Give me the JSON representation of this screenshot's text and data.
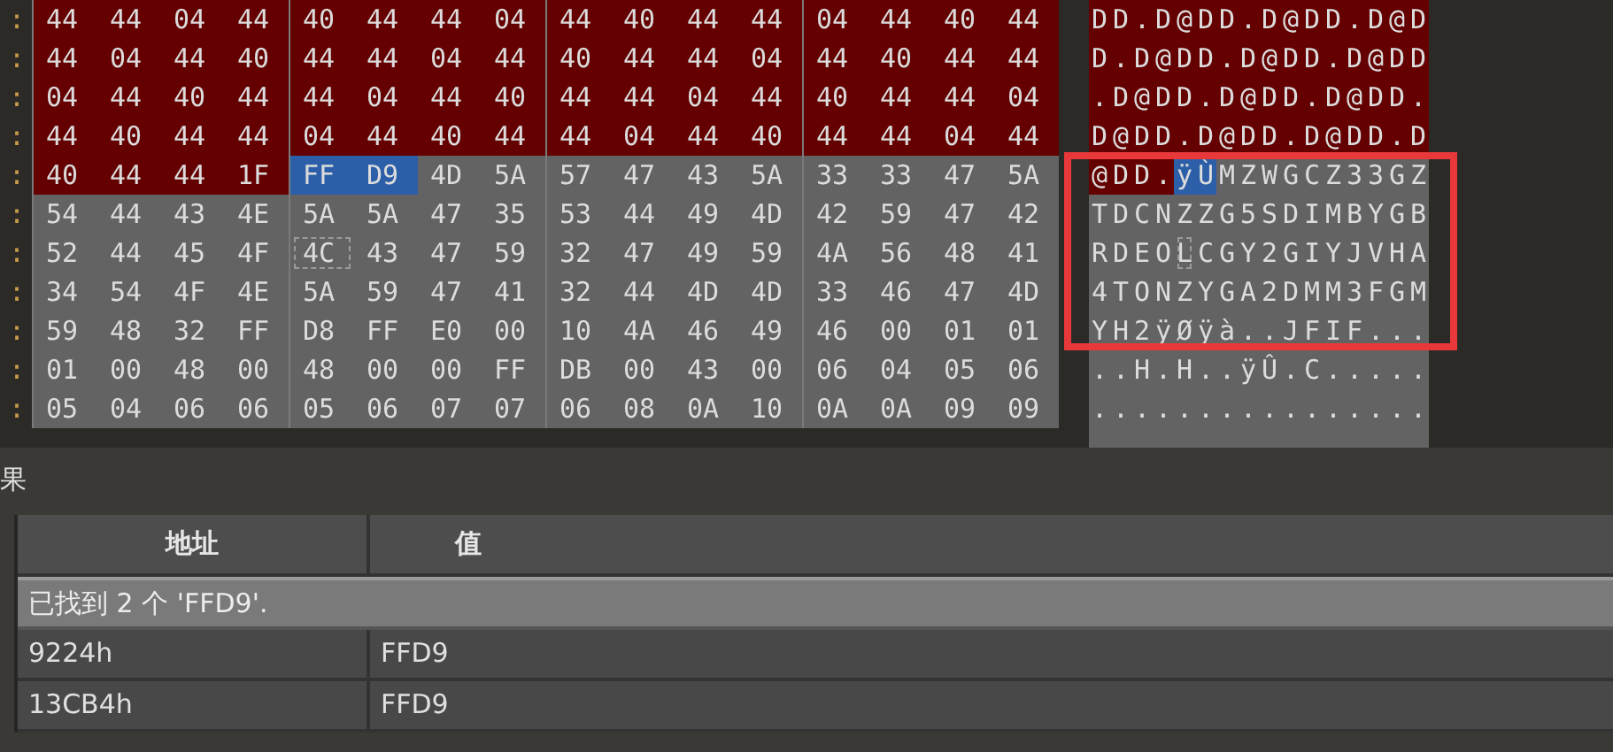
{
  "hex_view": {
    "rows": [
      {
        "address": ":",
        "bytes": [
          {
            "hex": "44",
            "kind": "marked",
            "selected": false
          },
          {
            "hex": "44",
            "kind": "marked",
            "selected": false
          },
          {
            "hex": "04",
            "kind": "marked",
            "selected": false
          },
          {
            "hex": "44",
            "kind": "marked",
            "selected": false
          },
          {
            "hex": "40",
            "kind": "marked",
            "selected": false
          },
          {
            "hex": "44",
            "kind": "marked",
            "selected": false
          },
          {
            "hex": "44",
            "kind": "marked",
            "selected": false
          },
          {
            "hex": "04",
            "kind": "marked",
            "selected": false
          },
          {
            "hex": "44",
            "kind": "marked",
            "selected": false
          },
          {
            "hex": "40",
            "kind": "marked",
            "selected": false
          },
          {
            "hex": "44",
            "kind": "marked",
            "selected": false
          },
          {
            "hex": "44",
            "kind": "marked",
            "selected": false
          },
          {
            "hex": "04",
            "kind": "marked",
            "selected": false
          },
          {
            "hex": "44",
            "kind": "marked",
            "selected": false
          },
          {
            "hex": "40",
            "kind": "marked",
            "selected": false
          },
          {
            "hex": "44",
            "kind": "marked",
            "selected": false
          }
        ],
        "ascii": "DD.D@DD.D@DD.D@D"
      },
      {
        "address": ":",
        "bytes": [
          {
            "hex": "44",
            "kind": "marked",
            "selected": false
          },
          {
            "hex": "04",
            "kind": "marked",
            "selected": false
          },
          {
            "hex": "44",
            "kind": "marked",
            "selected": false
          },
          {
            "hex": "40",
            "kind": "marked",
            "selected": false
          },
          {
            "hex": "44",
            "kind": "marked",
            "selected": false
          },
          {
            "hex": "44",
            "kind": "marked",
            "selected": false
          },
          {
            "hex": "04",
            "kind": "marked",
            "selected": false
          },
          {
            "hex": "44",
            "kind": "marked",
            "selected": false
          },
          {
            "hex": "40",
            "kind": "marked",
            "selected": false
          },
          {
            "hex": "44",
            "kind": "marked",
            "selected": false
          },
          {
            "hex": "44",
            "kind": "marked",
            "selected": false
          },
          {
            "hex": "04",
            "kind": "marked",
            "selected": false
          },
          {
            "hex": "44",
            "kind": "marked",
            "selected": false
          },
          {
            "hex": "40",
            "kind": "marked",
            "selected": false
          },
          {
            "hex": "44",
            "kind": "marked",
            "selected": false
          },
          {
            "hex": "44",
            "kind": "marked",
            "selected": false
          }
        ],
        "ascii": "D.D@DD.D@DD.D@DD"
      },
      {
        "address": ":",
        "bytes": [
          {
            "hex": "04",
            "kind": "marked",
            "selected": false
          },
          {
            "hex": "44",
            "kind": "marked",
            "selected": false
          },
          {
            "hex": "40",
            "kind": "marked",
            "selected": false
          },
          {
            "hex": "44",
            "kind": "marked",
            "selected": false
          },
          {
            "hex": "44",
            "kind": "marked",
            "selected": false
          },
          {
            "hex": "04",
            "kind": "marked",
            "selected": false
          },
          {
            "hex": "44",
            "kind": "marked",
            "selected": false
          },
          {
            "hex": "40",
            "kind": "marked",
            "selected": false
          },
          {
            "hex": "44",
            "kind": "marked",
            "selected": false
          },
          {
            "hex": "44",
            "kind": "marked",
            "selected": false
          },
          {
            "hex": "04",
            "kind": "marked",
            "selected": false
          },
          {
            "hex": "44",
            "kind": "marked",
            "selected": false
          },
          {
            "hex": "40",
            "kind": "marked",
            "selected": false
          },
          {
            "hex": "44",
            "kind": "marked",
            "selected": false
          },
          {
            "hex": "44",
            "kind": "marked",
            "selected": false
          },
          {
            "hex": "04",
            "kind": "marked",
            "selected": false
          }
        ],
        "ascii": ".D@DD.D@DD.D@DD."
      },
      {
        "address": ":",
        "bytes": [
          {
            "hex": "44",
            "kind": "marked",
            "selected": false
          },
          {
            "hex": "40",
            "kind": "marked",
            "selected": false
          },
          {
            "hex": "44",
            "kind": "marked",
            "selected": false
          },
          {
            "hex": "44",
            "kind": "marked",
            "selected": false
          },
          {
            "hex": "04",
            "kind": "marked",
            "selected": false
          },
          {
            "hex": "44",
            "kind": "marked",
            "selected": false
          },
          {
            "hex": "40",
            "kind": "marked",
            "selected": false
          },
          {
            "hex": "44",
            "kind": "marked",
            "selected": false
          },
          {
            "hex": "44",
            "kind": "marked",
            "selected": false
          },
          {
            "hex": "04",
            "kind": "marked",
            "selected": false
          },
          {
            "hex": "44",
            "kind": "marked",
            "selected": false
          },
          {
            "hex": "40",
            "kind": "marked",
            "selected": false
          },
          {
            "hex": "44",
            "kind": "marked",
            "selected": false
          },
          {
            "hex": "44",
            "kind": "marked",
            "selected": false
          },
          {
            "hex": "04",
            "kind": "marked",
            "selected": false
          },
          {
            "hex": "44",
            "kind": "marked",
            "selected": false
          }
        ],
        "ascii": "D@DD.D@DD.D@DD.D"
      },
      {
        "address": ":",
        "bytes": [
          {
            "hex": "40",
            "kind": "marked",
            "selected": false
          },
          {
            "hex": "44",
            "kind": "marked",
            "selected": false
          },
          {
            "hex": "44",
            "kind": "marked",
            "selected": false
          },
          {
            "hex": "1F",
            "kind": "marked",
            "selected": false
          },
          {
            "hex": "FF",
            "selected": true
          },
          {
            "hex": "D9",
            "selected": true
          },
          {
            "hex": "4D",
            "kind": "plain",
            "selected": false
          },
          {
            "hex": "5A",
            "kind": "plain",
            "selected": false
          },
          {
            "hex": "57",
            "kind": "plain",
            "selected": false
          },
          {
            "hex": "47",
            "kind": "plain",
            "selected": false
          },
          {
            "hex": "43",
            "kind": "plain",
            "selected": false
          },
          {
            "hex": "5A",
            "kind": "plain",
            "selected": false
          },
          {
            "hex": "33",
            "kind": "plain",
            "selected": false
          },
          {
            "hex": "33",
            "kind": "plain",
            "selected": false
          },
          {
            "hex": "47",
            "kind": "plain",
            "selected": false
          },
          {
            "hex": "5A",
            "kind": "plain",
            "selected": false
          }
        ],
        "ascii": "@DD.ÿÙMZWGCZ33GZ"
      },
      {
        "address": ":",
        "bytes": [
          {
            "hex": "54",
            "kind": "plain",
            "selected": false
          },
          {
            "hex": "44",
            "kind": "plain",
            "selected": false
          },
          {
            "hex": "43",
            "kind": "plain",
            "selected": false
          },
          {
            "hex": "4E",
            "kind": "plain",
            "selected": false
          },
          {
            "hex": "5A",
            "kind": "plain",
            "selected": false
          },
          {
            "hex": "5A",
            "kind": "plain",
            "selected": false
          },
          {
            "hex": "47",
            "kind": "plain",
            "selected": false
          },
          {
            "hex": "35",
            "kind": "plain",
            "selected": false
          },
          {
            "hex": "53",
            "kind": "plain",
            "selected": false
          },
          {
            "hex": "44",
            "kind": "plain",
            "selected": false
          },
          {
            "hex": "49",
            "kind": "plain",
            "selected": false
          },
          {
            "hex": "4D",
            "kind": "plain",
            "selected": false
          },
          {
            "hex": "42",
            "kind": "plain",
            "selected": false
          },
          {
            "hex": "59",
            "kind": "plain",
            "selected": false
          },
          {
            "hex": "47",
            "kind": "plain",
            "selected": false
          },
          {
            "hex": "42",
            "kind": "plain",
            "selected": false
          }
        ],
        "ascii": "TDCNZZG5SDIMBYGB"
      },
      {
        "address": ":",
        "bytes": [
          {
            "hex": "52",
            "kind": "plain",
            "selected": false
          },
          {
            "hex": "44",
            "kind": "plain",
            "selected": false
          },
          {
            "hex": "45",
            "kind": "plain",
            "selected": false
          },
          {
            "hex": "4F",
            "kind": "plain",
            "selected": false
          },
          {
            "hex": "4C",
            "kind": "cursor",
            "selected": false
          },
          {
            "hex": "43",
            "kind": "plain",
            "selected": false
          },
          {
            "hex": "47",
            "kind": "plain",
            "selected": false
          },
          {
            "hex": "59",
            "kind": "plain",
            "selected": false
          },
          {
            "hex": "32",
            "kind": "plain",
            "selected": false
          },
          {
            "hex": "47",
            "kind": "plain",
            "selected": false
          },
          {
            "hex": "49",
            "kind": "plain",
            "selected": false
          },
          {
            "hex": "59",
            "kind": "plain",
            "selected": false
          },
          {
            "hex": "4A",
            "kind": "plain",
            "selected": false
          },
          {
            "hex": "56",
            "kind": "plain",
            "selected": false
          },
          {
            "hex": "48",
            "kind": "plain",
            "selected": false
          },
          {
            "hex": "41",
            "kind": "plain",
            "selected": false
          }
        ],
        "ascii": "RDEOLCGY2GIYJVHA"
      },
      {
        "address": ":",
        "bytes": [
          {
            "hex": "34",
            "kind": "plain",
            "selected": false
          },
          {
            "hex": "54",
            "kind": "plain",
            "selected": false
          },
          {
            "hex": "4F",
            "kind": "plain",
            "selected": false
          },
          {
            "hex": "4E",
            "kind": "plain",
            "selected": false
          },
          {
            "hex": "5A",
            "kind": "plain",
            "selected": false
          },
          {
            "hex": "59",
            "kind": "plain",
            "selected": false
          },
          {
            "hex": "47",
            "kind": "plain",
            "selected": false
          },
          {
            "hex": "41",
            "kind": "plain",
            "selected": false
          },
          {
            "hex": "32",
            "kind": "plain",
            "selected": false
          },
          {
            "hex": "44",
            "kind": "plain",
            "selected": false
          },
          {
            "hex": "4D",
            "kind": "plain",
            "selected": false
          },
          {
            "hex": "4D",
            "kind": "plain",
            "selected": false
          },
          {
            "hex": "33",
            "kind": "plain",
            "selected": false
          },
          {
            "hex": "46",
            "kind": "plain",
            "selected": false
          },
          {
            "hex": "47",
            "kind": "plain",
            "selected": false
          },
          {
            "hex": "4D",
            "kind": "plain",
            "selected": false
          }
        ],
        "ascii": "4TONZYGA2DMM3FGM"
      },
      {
        "address": ":",
        "bytes": [
          {
            "hex": "59",
            "kind": "plain",
            "selected": false
          },
          {
            "hex": "48",
            "kind": "plain",
            "selected": false
          },
          {
            "hex": "32",
            "kind": "plain",
            "selected": false
          },
          {
            "hex": "FF",
            "kind": "plain",
            "selected": false
          },
          {
            "hex": "D8",
            "kind": "plain",
            "selected": false
          },
          {
            "hex": "FF",
            "kind": "plain",
            "selected": false
          },
          {
            "hex": "E0",
            "kind": "plain",
            "selected": false
          },
          {
            "hex": "00",
            "kind": "plain",
            "selected": false
          },
          {
            "hex": "10",
            "kind": "plain",
            "selected": false
          },
          {
            "hex": "4A",
            "kind": "plain",
            "selected": false
          },
          {
            "hex": "46",
            "kind": "plain",
            "selected": false
          },
          {
            "hex": "49",
            "kind": "plain",
            "selected": false
          },
          {
            "hex": "46",
            "kind": "plain",
            "selected": false
          },
          {
            "hex": "00",
            "kind": "plain",
            "selected": false
          },
          {
            "hex": "01",
            "kind": "plain",
            "selected": false
          },
          {
            "hex": "01",
            "kind": "plain",
            "selected": false
          }
        ],
        "ascii": "YH2ÿØÿà..JFIF..."
      },
      {
        "address": ":",
        "bytes": [
          {
            "hex": "01",
            "kind": "plain",
            "selected": false
          },
          {
            "hex": "00",
            "kind": "plain",
            "selected": false
          },
          {
            "hex": "48",
            "kind": "plain",
            "selected": false
          },
          {
            "hex": "00",
            "kind": "plain",
            "selected": false
          },
          {
            "hex": "48",
            "kind": "plain",
            "selected": false
          },
          {
            "hex": "00",
            "kind": "plain",
            "selected": false
          },
          {
            "hex": "00",
            "kind": "plain",
            "selected": false
          },
          {
            "hex": "FF",
            "kind": "plain",
            "selected": false
          },
          {
            "hex": "DB",
            "kind": "plain",
            "selected": false
          },
          {
            "hex": "00",
            "kind": "plain",
            "selected": false
          },
          {
            "hex": "43",
            "kind": "plain",
            "selected": false
          },
          {
            "hex": "00",
            "kind": "plain",
            "selected": false
          },
          {
            "hex": "06",
            "kind": "plain",
            "selected": false
          },
          {
            "hex": "04",
            "kind": "plain",
            "selected": false
          },
          {
            "hex": "05",
            "kind": "plain",
            "selected": false
          },
          {
            "hex": "06",
            "kind": "plain",
            "selected": false
          }
        ],
        "ascii": "..H.H..ÿÛ.C....."
      },
      {
        "address": ":",
        "bytes": [
          {
            "hex": "05",
            "kind": "plain",
            "selected": false
          },
          {
            "hex": "04",
            "kind": "plain",
            "selected": false
          },
          {
            "hex": "06",
            "kind": "plain",
            "selected": false
          },
          {
            "hex": "06",
            "kind": "plain",
            "selected": false
          },
          {
            "hex": "05",
            "kind": "plain",
            "selected": false
          },
          {
            "hex": "06",
            "kind": "plain",
            "selected": false
          },
          {
            "hex": "07",
            "kind": "plain",
            "selected": false
          },
          {
            "hex": "07",
            "kind": "plain",
            "selected": false
          },
          {
            "hex": "06",
            "kind": "plain",
            "selected": false
          },
          {
            "hex": "08",
            "kind": "plain",
            "selected": false
          },
          {
            "hex": "0A",
            "kind": "plain",
            "selected": false
          },
          {
            "hex": "10",
            "kind": "plain",
            "selected": false
          },
          {
            "hex": "0A",
            "kind": "plain",
            "selected": false
          },
          {
            "hex": "0A",
            "kind": "plain",
            "selected": false
          },
          {
            "hex": "09",
            "kind": "plain",
            "selected": false
          },
          {
            "hex": "09",
            "kind": "plain",
            "selected": false
          }
        ],
        "ascii": "................"
      }
    ]
  },
  "results": {
    "title": "果",
    "columns": [
      "地址",
      "值"
    ],
    "summary": "已找到 2 个 'FFD9'.",
    "rows": [
      {
        "address": "9224h",
        "value": "FFD9",
        "selected": false
      },
      {
        "address": "13CB4h",
        "value": "FFD9",
        "selected": false
      }
    ]
  }
}
